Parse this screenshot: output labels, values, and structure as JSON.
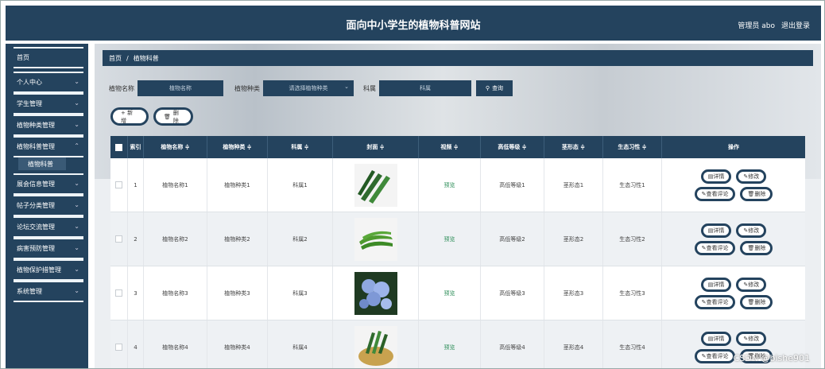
{
  "header": {
    "title": "面向中小学生的植物科普网站",
    "admin": "管理员 abo",
    "logout": "退出登录"
  },
  "sidebar": {
    "items": [
      {
        "label": "首页",
        "chevron": false
      },
      {
        "label": "个人中心",
        "chevron": true
      },
      {
        "label": "学生管理",
        "chevron": true
      },
      {
        "label": "植物种类管理",
        "chevron": true
      },
      {
        "label": "植物科普管理",
        "chevron": true,
        "expanded": true,
        "sub": "植物科普"
      },
      {
        "label": "展会信息管理",
        "chevron": true
      },
      {
        "label": "帖子分类管理",
        "chevron": true
      },
      {
        "label": "论坛交流管理",
        "chevron": true
      },
      {
        "label": "病害预防管理",
        "chevron": true
      },
      {
        "label": "植物保护措管理",
        "chevron": true
      },
      {
        "label": "系统管理",
        "chevron": true
      }
    ]
  },
  "breadcrumb": {
    "home": "首页",
    "sep": "/",
    "current": "植物科普"
  },
  "search": {
    "name_label": "植物名称",
    "name_placeholder": "植物名称",
    "type_label": "植物种类",
    "type_placeholder": "请选择植物种类",
    "family_label": "科属",
    "family_placeholder": "科属",
    "query": "查询"
  },
  "buttons": {
    "add": "+ 新增",
    "delete": "删除"
  },
  "table": {
    "headers": [
      "",
      "索引",
      "植物名称 ≑",
      "植物种类 ≑",
      "科属 ≑",
      "封面 ≑",
      "视频 ≑",
      "高低等级 ≑",
      "茎形态 ≑",
      "生态习性 ≑",
      "操作"
    ],
    "rows": [
      {
        "idx": "1",
        "name": "植物名称1",
        "type": "植物种类1",
        "family": "科属1",
        "video": "预览",
        "level": "高低等级1",
        "stem": "茎形态1",
        "habit": "生态习性1",
        "img": "cucumber"
      },
      {
        "idx": "2",
        "name": "植物名称2",
        "type": "植物种类2",
        "family": "科属2",
        "video": "预览",
        "level": "高低等级2",
        "stem": "茎形态2",
        "habit": "生态习性2",
        "img": "okra"
      },
      {
        "idx": "3",
        "name": "植物名称3",
        "type": "植物种类3",
        "family": "科属3",
        "video": "预览",
        "level": "高低等级3",
        "stem": "茎形态3",
        "habit": "生态习性3",
        "img": "flower"
      },
      {
        "idx": "4",
        "name": "植物名称4",
        "type": "植物种类4",
        "family": "科属4",
        "video": "预览",
        "level": "高低等级4",
        "stem": "茎形态4",
        "habit": "生态习性4",
        "img": "basket"
      }
    ],
    "ops": {
      "detail": "详情",
      "edit": "修改",
      "review": "查看评论",
      "delete": "删除"
    }
  },
  "watermark": "CSDN @bishe901",
  "colors": {
    "primary": "#24435e",
    "preview": "#2f8f5a"
  }
}
